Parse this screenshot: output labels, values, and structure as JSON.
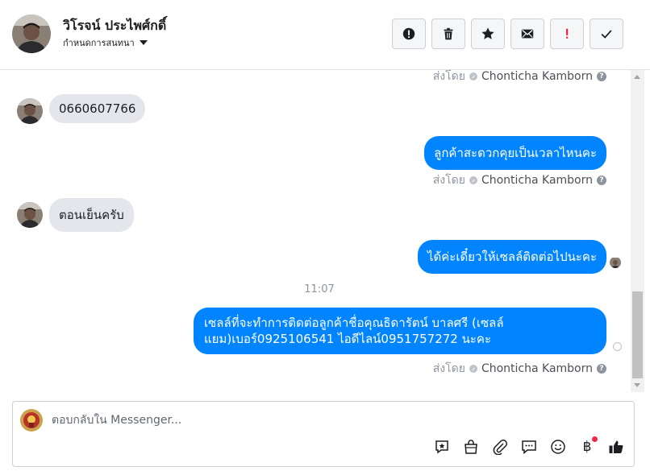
{
  "header": {
    "contact_name": "วิโรจน์ ประไพศ์กดิ์",
    "assign_label": "กำหนดการสนทนา",
    "actions": [
      {
        "name": "mark-spam-button",
        "icon": "alert-circle-icon"
      },
      {
        "name": "delete-button",
        "icon": "trash-icon"
      },
      {
        "name": "star-button",
        "icon": "star-icon"
      },
      {
        "name": "mark-unread-button",
        "icon": "envelope-icon"
      },
      {
        "name": "follow-up-button",
        "icon": "exclamation-icon"
      },
      {
        "name": "mark-done-button",
        "icon": "checkmark-icon"
      }
    ]
  },
  "thread": {
    "sent_by_label": "ส่งโดย",
    "agent_name": "Chonticha Kamborn",
    "messages": {
      "in_1": "0660607766",
      "out_1": "ลูกค้าสะดวกคุยเป็นเวลาไหนคะ",
      "in_2": "ตอนเย็นครับ",
      "out_2": "ได้ค่ะเดี๋ยวให้เซลล์ติดต่อไปนะคะ",
      "timestamp": "11:07",
      "out_3": "เซลล์ที่จะทำการติดต่อลูกค้าชื่อคุณธิดารัตน์ บาลศรี (เซลล์แยม)เบอร์0925106541 ไอดีไลน์0951757272 นะคะ"
    }
  },
  "composer": {
    "placeholder": "ตอบกลับใน Messenger...",
    "tools": [
      "saved-reply-icon",
      "shopping-bag-icon",
      "paperclip-icon",
      "chat-bubble-icon",
      "emoji-icon",
      "baht-payment-icon",
      "thumbs-up-icon"
    ],
    "baht_symbol": "฿"
  },
  "colors": {
    "outgoing_bubble": "#0084ff",
    "incoming_bubble": "#e4e6eb",
    "follow_up_red": "#e41e3f",
    "notification_dot": "#f02849"
  }
}
